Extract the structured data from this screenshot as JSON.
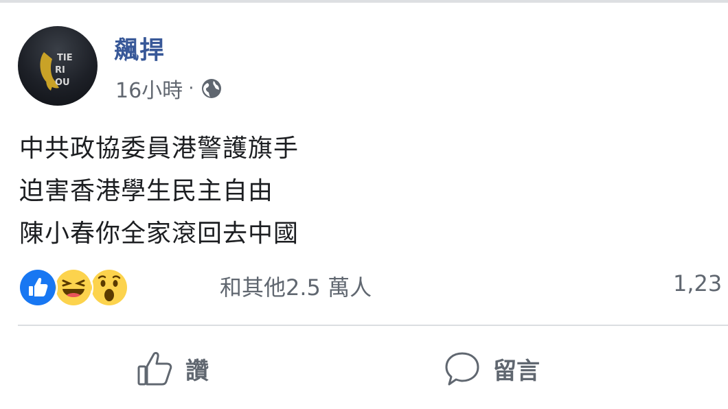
{
  "post": {
    "author": "飆捍",
    "timestamp": "16小時",
    "separator": "·",
    "privacy_icon": "globe-icon",
    "lines": [
      "中共政協委員港警護旗手",
      "迫害香港學生民主自由",
      "陳小春你全家滾回去中國"
    ]
  },
  "reactions": {
    "icons": [
      "like-reaction-icon",
      "haha-reaction-icon",
      "wow-reaction-icon"
    ],
    "summary": "和其他2.5 萬人",
    "comment_count": "1,23"
  },
  "actions": {
    "like_label": "讚",
    "comment_label": "留言"
  },
  "colors": {
    "author_link": "#385898",
    "like_blue": "#1877f2",
    "reaction_yellow": "#fcd34d",
    "muted_text": "#606770",
    "divider": "#dadde1"
  }
}
